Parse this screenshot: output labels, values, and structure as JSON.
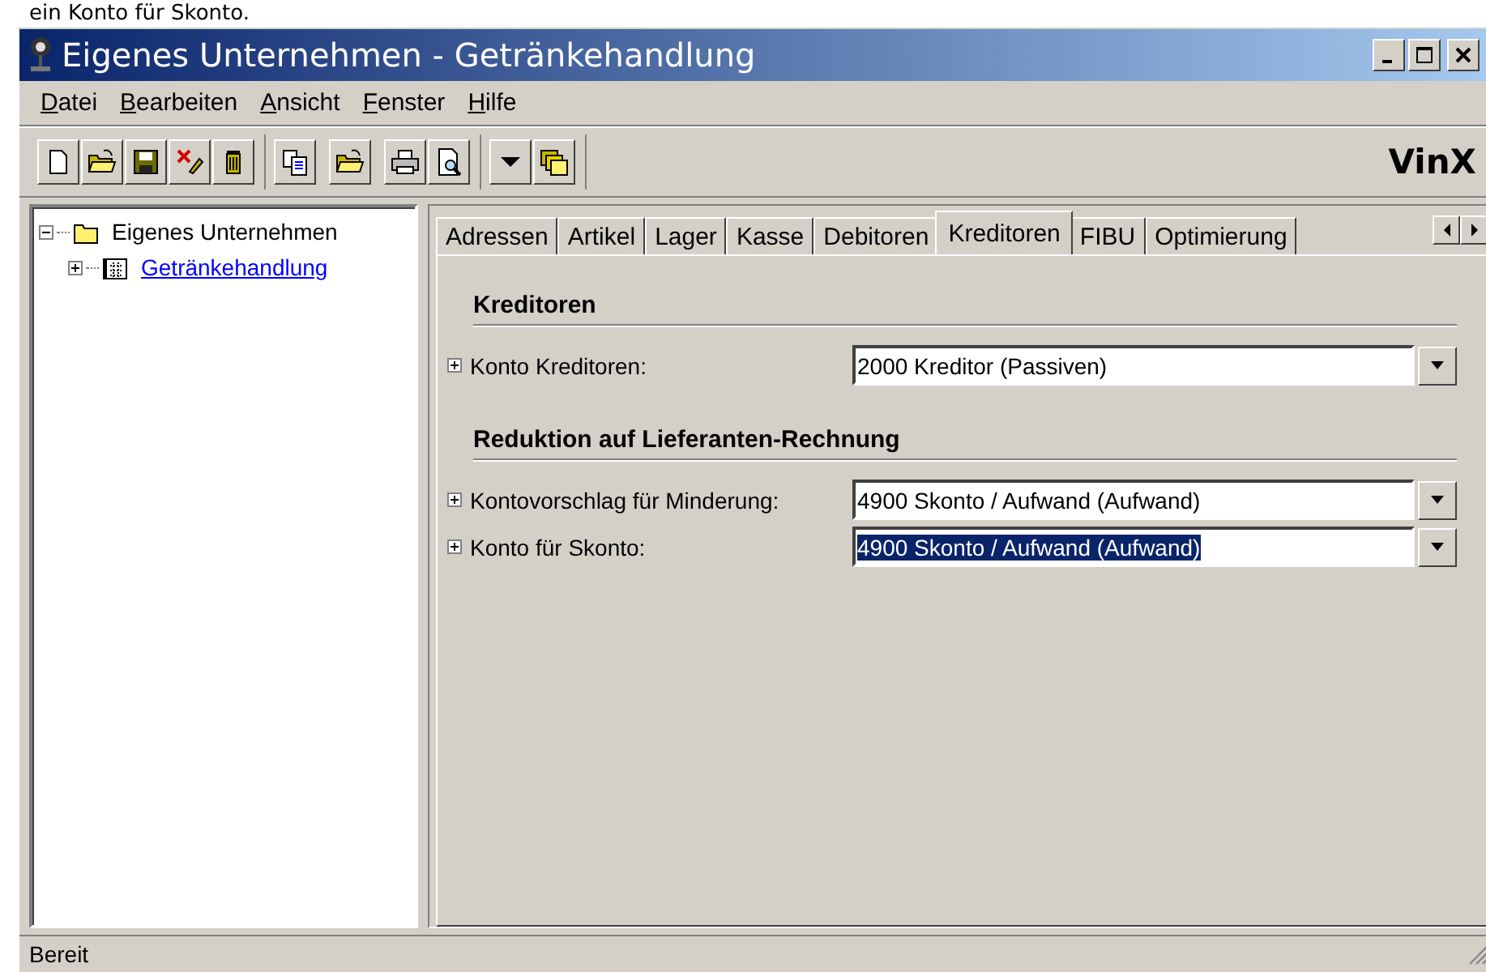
{
  "caption": "ein Konto für Skonto.",
  "window": {
    "title": "Eigenes Unternehmen - Getränkehandlung"
  },
  "menu": [
    {
      "label": "Datei"
    },
    {
      "label": "Bearbeiten"
    },
    {
      "label": "Ansicht"
    },
    {
      "label": "Fenster"
    },
    {
      "label": "Hilfe"
    }
  ],
  "toolbar": [
    [
      {
        "kind": "new"
      },
      {
        "kind": "open"
      },
      {
        "kind": "save"
      },
      {
        "kind": "delete"
      },
      {
        "kind": "trash"
      }
    ],
    [
      {
        "kind": "copy"
      }
    ],
    [
      {
        "kind": "open"
      }
    ],
    [
      {
        "kind": "print"
      },
      {
        "kind": "preview"
      }
    ],
    [
      {
        "kind": "dropdown"
      },
      {
        "kind": "folders"
      }
    ]
  ],
  "logo": "VinX",
  "tree": [
    {
      "label": "Eigenes Unternehmen",
      "kind": "folder",
      "expanded": true,
      "link": false,
      "children": [
        {
          "label": "Getränkehandlung",
          "kind": "calendar",
          "expanded": false,
          "link": true
        }
      ]
    }
  ],
  "tabs": [
    {
      "label": "Adressen",
      "selected": false
    },
    {
      "label": "Artikel",
      "selected": false
    },
    {
      "label": "Lager",
      "selected": false
    },
    {
      "label": "Kasse",
      "selected": false
    },
    {
      "label": "Debitoren",
      "selected": false
    },
    {
      "label": "Kreditoren",
      "selected": true
    },
    {
      "label": "FIBU",
      "selected": false
    },
    {
      "label": "Optimierung",
      "selected": false
    }
  ],
  "sections": [
    {
      "heading": "Kreditoren",
      "rows": [
        {
          "label": "Konto Kreditoren:",
          "value": "2000 Kreditor (Passiven)",
          "expanded": false,
          "selected": false
        }
      ]
    },
    {
      "heading": "Reduktion auf Lieferanten-Rechnung",
      "rows": [
        {
          "label": "Kontovorschlag für Minderung:",
          "value": "4900 Skonto / Aufwand (Aufwand)",
          "expanded": false,
          "selected": false
        },
        {
          "label": "Konto für Skonto:",
          "value": "4900 Skonto / Aufwand (Aufwand)",
          "expanded": false,
          "selected": true
        }
      ]
    }
  ],
  "status_bar": "Bereit"
}
